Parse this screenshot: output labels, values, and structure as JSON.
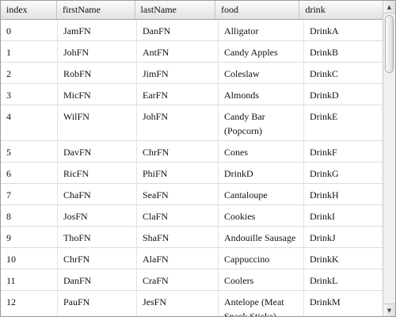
{
  "columns": [
    "index",
    "firstName",
    "lastName",
    "food",
    "drink"
  ],
  "rows": [
    [
      "0",
      "JamFN",
      "DanFN",
      "Alligator",
      "DrinkA"
    ],
    [
      "1",
      "JohFN",
      "AntFN",
      "Candy Apples",
      "DrinkB"
    ],
    [
      "2",
      "RobFN",
      "JimFN",
      "Coleslaw",
      "DrinkC"
    ],
    [
      "3",
      "MicFN",
      "EarFN",
      "Almonds",
      "DrinkD"
    ],
    [
      "4",
      "WilFN",
      "JohFN",
      "Candy Bar (Popcorn)",
      "DrinkE"
    ],
    [
      "5",
      "DavFN",
      "ChrFN",
      "Cones",
      "DrinkF"
    ],
    [
      "6",
      "RicFN",
      "PhiFN",
      "DrinkD",
      "DrinkG"
    ],
    [
      "7",
      "ChaFN",
      "SeaFN",
      "Cantaloupe",
      "DrinkH"
    ],
    [
      "8",
      "JosFN",
      "ClaFN",
      "Cookies",
      "DrinkI"
    ],
    [
      "9",
      "ThoFN",
      "ShaFN",
      "Andouille Sausage",
      "DrinkJ"
    ],
    [
      "10",
      "ChrFN",
      "AlaFN",
      "Cappuccino",
      "DrinkK"
    ],
    [
      "11",
      "DanFN",
      "CraFN",
      "Coolers",
      "DrinkL"
    ],
    [
      "12",
      "PauFN",
      "JesFN",
      "Antelope (Meat Snack Sticks)",
      "DrinkM"
    ]
  ],
  "scroll": {
    "position_fraction": 0.0,
    "visible_fraction": 0.2
  },
  "icons": {
    "scroll_up": "arrow-up-icon",
    "scroll_down": "arrow-down-icon"
  }
}
